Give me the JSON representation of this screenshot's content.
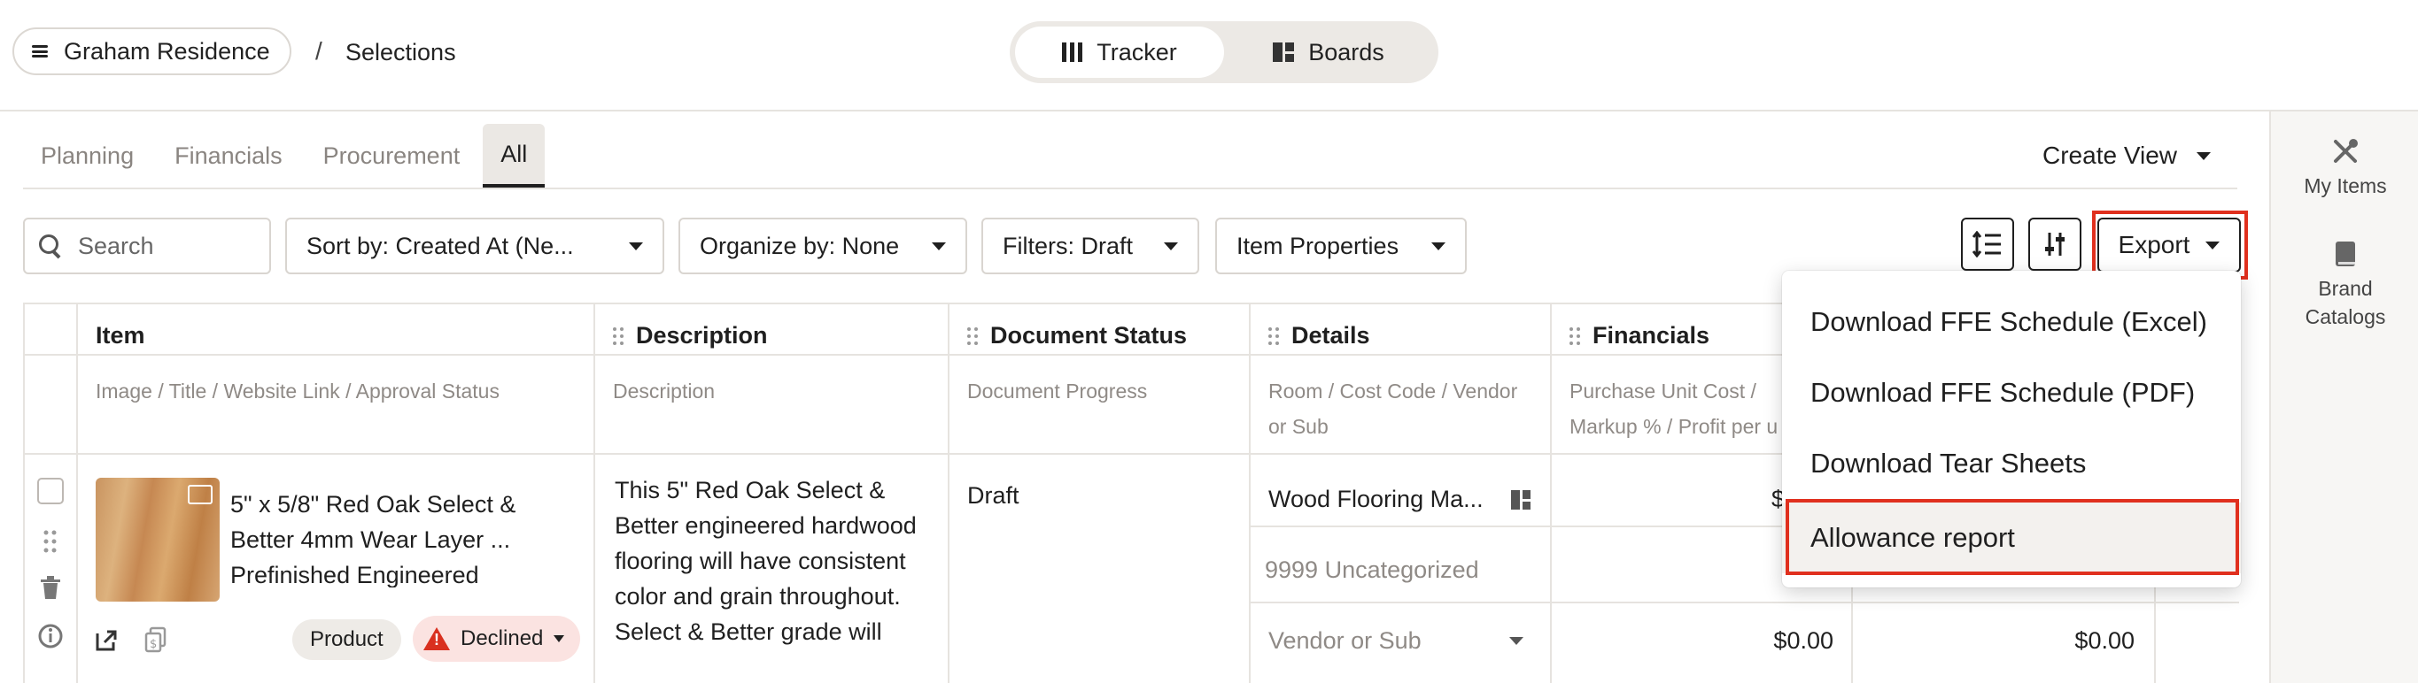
{
  "breadcrumb": {
    "project": "Graham Residence",
    "separator": "/",
    "page": "Selections"
  },
  "view_toggle": [
    {
      "label": "Tracker",
      "active": true
    },
    {
      "label": "Boards",
      "active": false
    }
  ],
  "tabs": [
    {
      "label": "Planning"
    },
    {
      "label": "Financials"
    },
    {
      "label": "Procurement"
    },
    {
      "label": "All",
      "active": true
    }
  ],
  "create_view": "Create View",
  "toolbar": {
    "search_placeholder": "Search",
    "sort": "Sort by: Created At (Ne...",
    "organize": "Organize by: None",
    "filters": "Filters: Draft",
    "item_properties": "Item Properties",
    "export": "Export"
  },
  "export_menu": [
    {
      "label": "Download FFE Schedule (Excel)"
    },
    {
      "label": "Download FFE Schedule (PDF)"
    },
    {
      "label": "Download Tear Sheets"
    },
    {
      "label": "Allowance report",
      "highlighted": true
    }
  ],
  "rail": [
    {
      "label_1": "My Items",
      "label_2": ""
    },
    {
      "label_1": "Brand",
      "label_2": "Catalogs"
    }
  ],
  "table": {
    "columns": [
      {
        "title": "Item",
        "sub": "Image / Title / Website Link / Approval Status"
      },
      {
        "title": "Description",
        "sub": "Description"
      },
      {
        "title": "Document Status",
        "sub": "Document Progress"
      },
      {
        "title": "Details",
        "sub_1": "Room / Cost Code / Vendor",
        "sub_2": "or Sub"
      },
      {
        "title": "Financials",
        "sub_1": "Purchase Unit Cost /",
        "sub_2": "Markup % / Profit per u"
      }
    ],
    "row": {
      "title_1": "5\" x 5/8\" Red Oak Select &",
      "title_2": "Better 4mm Wear Layer ...",
      "title_3": "Prefinished Engineered",
      "type": "Product",
      "approval": "Declined",
      "description_lines": [
        "This 5\" Red Oak Select &",
        "Better engineered hardwood",
        "flooring will have consistent",
        "color and grain throughout.",
        "Select & Better grade will"
      ],
      "document_status": "Draft",
      "room": "Wood Flooring Ma...",
      "cost_code": "9999 Uncategorized",
      "vendor_placeholder": "Vendor or Sub",
      "amount_partial": "$",
      "amount_1": "$0.00",
      "amount_2": "$0.00"
    }
  },
  "colors": {
    "highlight_border": "#e0301e",
    "declined_bg": "#fbe3e1",
    "warning": "#d9301f"
  }
}
